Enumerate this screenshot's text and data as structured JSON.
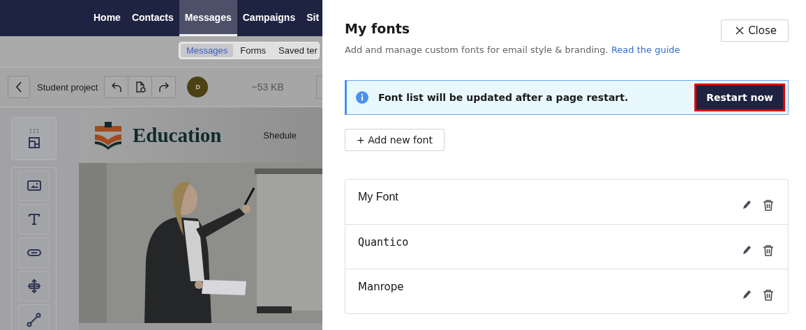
{
  "top_nav": {
    "items": [
      {
        "label": "Home",
        "selected": false
      },
      {
        "label": "Contacts",
        "selected": false
      },
      {
        "label": "Messages",
        "selected": true
      },
      {
        "label": "Campaigns",
        "selected": false
      },
      {
        "label": "Sit",
        "selected": false
      }
    ]
  },
  "sub_nav": {
    "items": [
      {
        "label": "Messages",
        "selected": true
      },
      {
        "label": "Forms",
        "selected": false
      },
      {
        "label": "Saved ter",
        "selected": false
      }
    ]
  },
  "editor_toolbar": {
    "project_name": "Student project",
    "avatar_initial": "D",
    "size": "~53 KB"
  },
  "canvas": {
    "logo_text": "Education",
    "menu_link": "Shedule"
  },
  "drawer": {
    "title": "My fonts",
    "close_label": "Close",
    "description": "Add and manage custom fonts for email style & branding.",
    "guide_link": "Read the guide",
    "notice": {
      "text": "Font list will be updated after a page restart.",
      "action": "Restart now",
      "highlighted": true
    },
    "add_button": "+ Add new font",
    "fonts": [
      {
        "name": "My Font"
      },
      {
        "name": "Quantico"
      },
      {
        "name": "Manrope"
      }
    ]
  }
}
